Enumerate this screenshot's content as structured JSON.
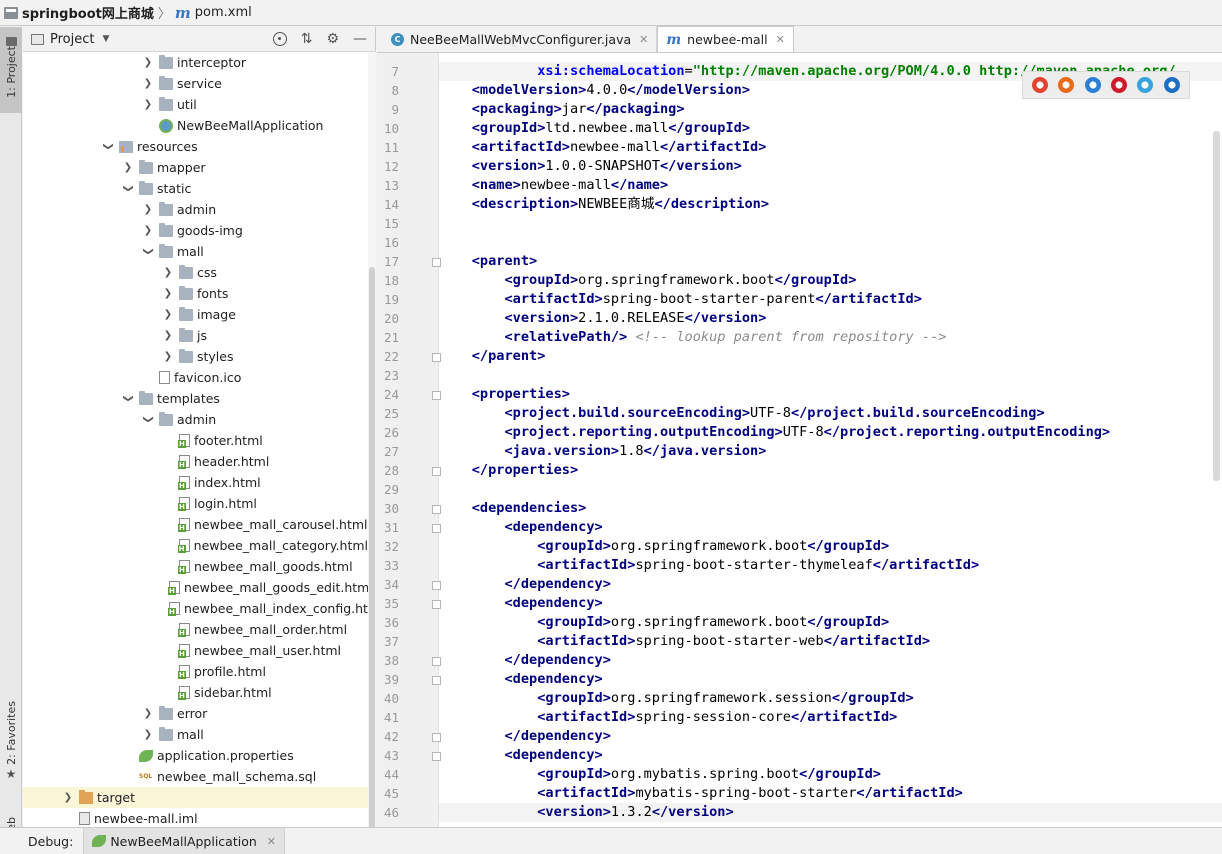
{
  "breadcrumb": {
    "project": "springboot网上商城",
    "file": "pom.xml"
  },
  "left_strip": {
    "project_tab": "1: Project",
    "favorites_tab": "2: Favorites",
    "web_tab": "Web"
  },
  "project_panel": {
    "title": "Project"
  },
  "tree": [
    {
      "label": "interceptor",
      "indent": 1,
      "arrow": "right",
      "icon": "folder"
    },
    {
      "label": "service",
      "indent": 1,
      "arrow": "right",
      "icon": "folder"
    },
    {
      "label": "util",
      "indent": 1,
      "arrow": "right",
      "icon": "folder"
    },
    {
      "label": "NewBeeMallApplication",
      "indent": 1,
      "arrow": "",
      "icon": "app"
    },
    {
      "label": "resources",
      "indent": -1,
      "arrow": "down",
      "icon": "folder-res"
    },
    {
      "label": "mapper",
      "indent": 0,
      "arrow": "right",
      "icon": "folder"
    },
    {
      "label": "static",
      "indent": 0,
      "arrow": "down",
      "icon": "folder"
    },
    {
      "label": "admin",
      "indent": 1,
      "arrow": "right",
      "icon": "folder"
    },
    {
      "label": "goods-img",
      "indent": 1,
      "arrow": "right",
      "icon": "folder"
    },
    {
      "label": "mall",
      "indent": 1,
      "arrow": "down",
      "icon": "folder"
    },
    {
      "label": "css",
      "indent": 2,
      "arrow": "right",
      "icon": "folder"
    },
    {
      "label": "fonts",
      "indent": 2,
      "arrow": "right",
      "icon": "folder"
    },
    {
      "label": "image",
      "indent": 2,
      "arrow": "right",
      "icon": "folder"
    },
    {
      "label": "js",
      "indent": 2,
      "arrow": "right",
      "icon": "folder"
    },
    {
      "label": "styles",
      "indent": 2,
      "arrow": "right",
      "icon": "folder"
    },
    {
      "label": "favicon.ico",
      "indent": 1,
      "arrow": "",
      "icon": "file"
    },
    {
      "label": "templates",
      "indent": 0,
      "arrow": "down",
      "icon": "folder"
    },
    {
      "label": "admin",
      "indent": 1,
      "arrow": "down",
      "icon": "folder"
    },
    {
      "label": "footer.html",
      "indent": 2,
      "arrow": "",
      "icon": "html"
    },
    {
      "label": "header.html",
      "indent": 2,
      "arrow": "",
      "icon": "html"
    },
    {
      "label": "index.html",
      "indent": 2,
      "arrow": "",
      "icon": "html"
    },
    {
      "label": "login.html",
      "indent": 2,
      "arrow": "",
      "icon": "html"
    },
    {
      "label": "newbee_mall_carousel.html",
      "indent": 2,
      "arrow": "",
      "icon": "html"
    },
    {
      "label": "newbee_mall_category.html",
      "indent": 2,
      "arrow": "",
      "icon": "html"
    },
    {
      "label": "newbee_mall_goods.html",
      "indent": 2,
      "arrow": "",
      "icon": "html"
    },
    {
      "label": "newbee_mall_goods_edit.html",
      "indent": 2,
      "arrow": "",
      "icon": "html"
    },
    {
      "label": "newbee_mall_index_config.html",
      "indent": 2,
      "arrow": "",
      "icon": "html"
    },
    {
      "label": "newbee_mall_order.html",
      "indent": 2,
      "arrow": "",
      "icon": "html"
    },
    {
      "label": "newbee_mall_user.html",
      "indent": 2,
      "arrow": "",
      "icon": "html"
    },
    {
      "label": "profile.html",
      "indent": 2,
      "arrow": "",
      "icon": "html"
    },
    {
      "label": "sidebar.html",
      "indent": 2,
      "arrow": "",
      "icon": "html"
    },
    {
      "label": "error",
      "indent": 1,
      "arrow": "right",
      "icon": "folder"
    },
    {
      "label": "mall",
      "indent": 1,
      "arrow": "right",
      "icon": "folder"
    },
    {
      "label": "application.properties",
      "indent": 0,
      "arrow": "",
      "icon": "leaf"
    },
    {
      "label": "newbee_mall_schema.sql",
      "indent": 0,
      "arrow": "",
      "icon": "sql"
    },
    {
      "label": "target",
      "indent": -3,
      "arrow": "right",
      "icon": "folder-orange",
      "selected": true
    },
    {
      "label": "newbee-mall.iml",
      "indent": -3,
      "arrow": "",
      "icon": "iml"
    }
  ],
  "editor": {
    "tabs": [
      {
        "label": "NeeBeeMallWebMvcConfigurer.java",
        "icon": "c",
        "active": false
      },
      {
        "label": "newbee-mall",
        "icon": "m",
        "active": true
      }
    ],
    "lines": [
      {
        "n": "7",
        "fold": false,
        "html": "            <span class=\"at\">xsi:schemaLocation</span>=<span class=\"str\">\"http://maven.apache.org/POM/4.0.0 http://maven.apache.org/</span>",
        "hl": true
      },
      {
        "n": "8",
        "fold": false,
        "html": "    <span class=\"tg\">&lt;modelVersion&gt;</span>4.0.0<span class=\"tg\">&lt;/modelVersion&gt;</span>"
      },
      {
        "n": "9",
        "fold": false,
        "html": "    <span class=\"tg\">&lt;packaging&gt;</span>jar<span class=\"tg\">&lt;/packaging&gt;</span>"
      },
      {
        "n": "10",
        "fold": false,
        "html": "    <span class=\"tg\">&lt;groupId&gt;</span>ltd.newbee.mall<span class=\"tg\">&lt;/groupId&gt;</span>"
      },
      {
        "n": "11",
        "fold": false,
        "html": "    <span class=\"tg\">&lt;artifactId&gt;</span>newbee-mall<span class=\"tg\">&lt;/artifactId&gt;</span>"
      },
      {
        "n": "12",
        "fold": false,
        "html": "    <span class=\"tg\">&lt;version&gt;</span>1.0.0-SNAPSHOT<span class=\"tg\">&lt;/version&gt;</span>"
      },
      {
        "n": "13",
        "fold": false,
        "html": "    <span class=\"tg\">&lt;name&gt;</span>newbee-mall<span class=\"tg\">&lt;/name&gt;</span>"
      },
      {
        "n": "14",
        "fold": false,
        "html": "    <span class=\"tg\">&lt;description&gt;</span>NEWBEE商城<span class=\"tg\">&lt;/description&gt;</span>"
      },
      {
        "n": "15",
        "fold": false,
        "html": ""
      },
      {
        "n": "16",
        "fold": false,
        "html": ""
      },
      {
        "n": "17",
        "fold": true,
        "html": "    <span class=\"tg\">&lt;parent&gt;</span>"
      },
      {
        "n": "18",
        "fold": false,
        "html": "        <span class=\"tg\">&lt;groupId&gt;</span>org.springframework.boot<span class=\"tg\">&lt;/groupId&gt;</span>"
      },
      {
        "n": "19",
        "fold": false,
        "html": "        <span class=\"tg\">&lt;artifactId&gt;</span>spring-boot-starter-parent<span class=\"tg\">&lt;/artifactId&gt;</span>"
      },
      {
        "n": "20",
        "fold": false,
        "html": "        <span class=\"tg\">&lt;version&gt;</span>2.1.0.RELEASE<span class=\"tg\">&lt;/version&gt;</span>"
      },
      {
        "n": "21",
        "fold": false,
        "html": "        <span class=\"tg\">&lt;relativePath/&gt;</span> <span class=\"cm\">&lt;!-- lookup parent from repository --&gt;</span>"
      },
      {
        "n": "22",
        "fold": true,
        "html": "    <span class=\"tg\">&lt;/parent&gt;</span>"
      },
      {
        "n": "23",
        "fold": false,
        "html": ""
      },
      {
        "n": "24",
        "fold": true,
        "html": "    <span class=\"tg\">&lt;properties&gt;</span>"
      },
      {
        "n": "25",
        "fold": false,
        "html": "        <span class=\"tg\">&lt;project.build.sourceEncoding&gt;</span>UTF-8<span class=\"tg\">&lt;/project.build.sourceEncoding&gt;</span>"
      },
      {
        "n": "26",
        "fold": false,
        "html": "        <span class=\"tg\">&lt;project.reporting.outputEncoding&gt;</span>UTF-8<span class=\"tg\">&lt;/project.reporting.outputEncoding&gt;</span>"
      },
      {
        "n": "27",
        "fold": false,
        "html": "        <span class=\"tg\">&lt;java.version&gt;</span>1.8<span class=\"tg\">&lt;/java.version&gt;</span>"
      },
      {
        "n": "28",
        "fold": true,
        "html": "    <span class=\"tg\">&lt;/properties&gt;</span>"
      },
      {
        "n": "29",
        "fold": false,
        "html": ""
      },
      {
        "n": "30",
        "fold": true,
        "html": "    <span class=\"tg\">&lt;dependencies&gt;</span>"
      },
      {
        "n": "31",
        "fold": true,
        "html": "        <span class=\"tg\">&lt;dependency&gt;</span>"
      },
      {
        "n": "32",
        "fold": false,
        "html": "            <span class=\"tg\">&lt;groupId&gt;</span>org.springframework.boot<span class=\"tg\">&lt;/groupId&gt;</span>"
      },
      {
        "n": "33",
        "fold": false,
        "html": "            <span class=\"tg\">&lt;artifactId&gt;</span>spring-boot-starter-thymeleaf<span class=\"tg\">&lt;/artifactId&gt;</span>"
      },
      {
        "n": "34",
        "fold": true,
        "html": "        <span class=\"tg\">&lt;/dependency&gt;</span>"
      },
      {
        "n": "35",
        "fold": true,
        "html": "        <span class=\"tg\">&lt;dependency&gt;</span>"
      },
      {
        "n": "36",
        "fold": false,
        "html": "            <span class=\"tg\">&lt;groupId&gt;</span>org.springframework.boot<span class=\"tg\">&lt;/groupId&gt;</span>"
      },
      {
        "n": "37",
        "fold": false,
        "html": "            <span class=\"tg\">&lt;artifactId&gt;</span>spring-boot-starter-web<span class=\"tg\">&lt;/artifactId&gt;</span>"
      },
      {
        "n": "38",
        "fold": true,
        "html": "        <span class=\"tg\">&lt;/dependency&gt;</span>"
      },
      {
        "n": "39",
        "fold": true,
        "html": "        <span class=\"tg\">&lt;dependency&gt;</span>"
      },
      {
        "n": "40",
        "fold": false,
        "html": "            <span class=\"tg\">&lt;groupId&gt;</span>org.springframework.session<span class=\"tg\">&lt;/groupId&gt;</span>"
      },
      {
        "n": "41",
        "fold": false,
        "html": "            <span class=\"tg\">&lt;artifactId&gt;</span>spring-session-core<span class=\"tg\">&lt;/artifactId&gt;</span>"
      },
      {
        "n": "42",
        "fold": true,
        "html": "        <span class=\"tg\">&lt;/dependency&gt;</span>"
      },
      {
        "n": "43",
        "fold": true,
        "html": "        <span class=\"tg\">&lt;dependency&gt;</span>"
      },
      {
        "n": "44",
        "fold": false,
        "html": "            <span class=\"tg\">&lt;groupId&gt;</span>org.mybatis.spring.boot<span class=\"tg\">&lt;/groupId&gt;</span>"
      },
      {
        "n": "45",
        "fold": false,
        "html": "            <span class=\"tg\">&lt;artifactId&gt;</span>mybatis-spring-boot-starter<span class=\"tg\">&lt;/artifactId&gt;</span>"
      },
      {
        "n": "46",
        "fold": false,
        "html": "            <span class=\"tg\">&lt;version&gt;</span>1.3.2<span class=\"tg\">&lt;/version&gt;</span>",
        "hl": true
      }
    ],
    "browser_icons": [
      {
        "name": "chrome-icon",
        "color": "#e0442e"
      },
      {
        "name": "firefox-icon",
        "color": "#e86b1a"
      },
      {
        "name": "safari-icon",
        "color": "#2b7fd4"
      },
      {
        "name": "opera-icon",
        "color": "#cc1b2c"
      },
      {
        "name": "ie-icon",
        "color": "#37a3dc"
      },
      {
        "name": "edge-icon",
        "color": "#1e6fc3"
      }
    ]
  },
  "debug": {
    "label": "Debug:",
    "tab": "NewBeeMallApplication"
  }
}
